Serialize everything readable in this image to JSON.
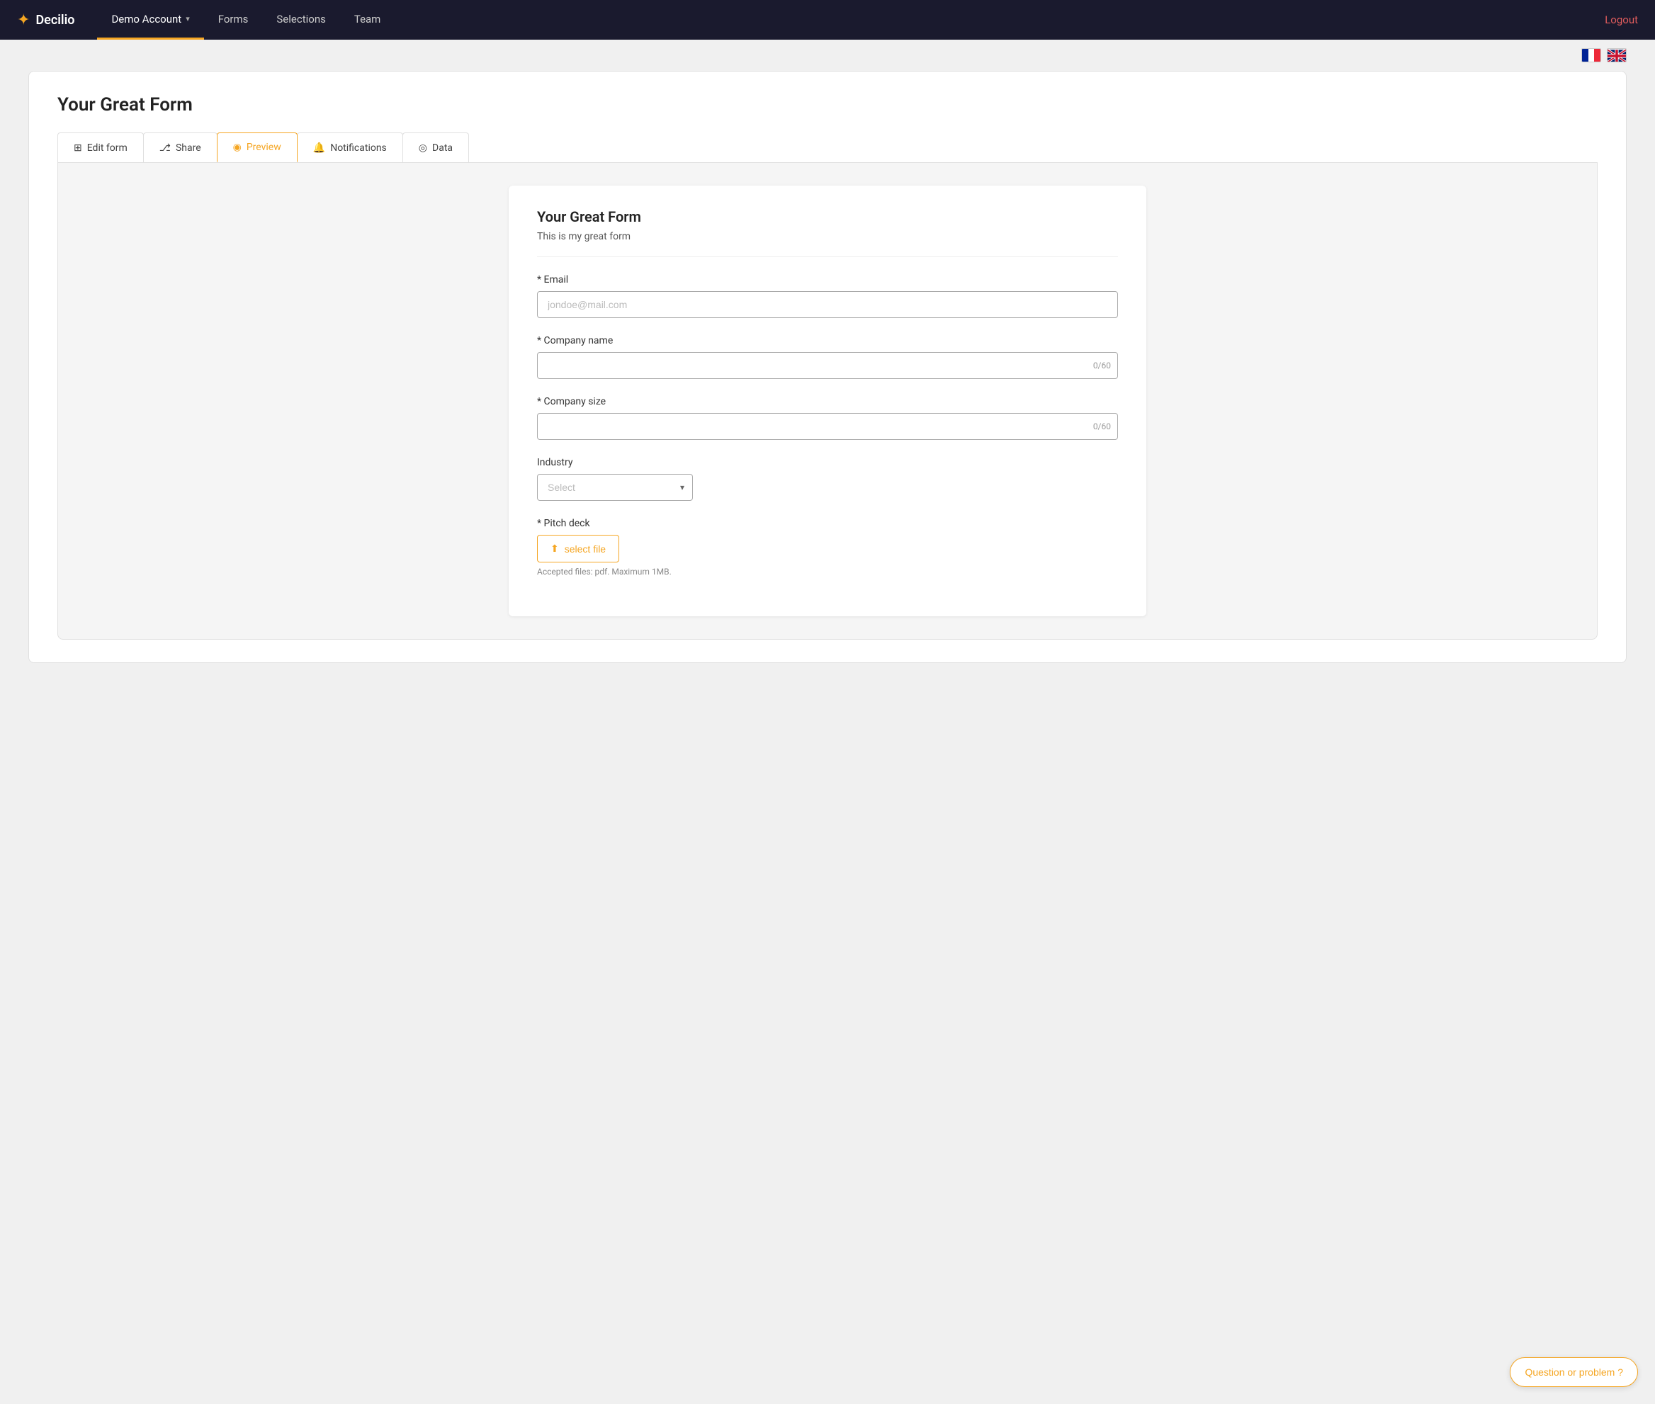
{
  "brand": {
    "logo_icon": "❯",
    "logo_text": "Decilio"
  },
  "navbar": {
    "items": [
      {
        "id": "demo-account",
        "label": "Demo Account",
        "active": true,
        "has_chevron": true
      },
      {
        "id": "forms",
        "label": "Forms",
        "active": false,
        "has_chevron": false
      },
      {
        "id": "selections",
        "label": "Selections",
        "active": false,
        "has_chevron": false
      },
      {
        "id": "team",
        "label": "Team",
        "active": false,
        "has_chevron": false
      }
    ],
    "logout_label": "Logout"
  },
  "page": {
    "form_title": "Your Great Form",
    "tabs": [
      {
        "id": "edit-form",
        "label": "Edit form",
        "icon": "⊞",
        "active": false
      },
      {
        "id": "share",
        "label": "Share",
        "icon": "⎇",
        "active": false
      },
      {
        "id": "preview",
        "label": "Preview",
        "icon": "◉",
        "active": true
      },
      {
        "id": "notifications",
        "label": "Notifications",
        "icon": "🔔",
        "active": false
      },
      {
        "id": "data",
        "label": "Data",
        "icon": "◎",
        "active": false
      }
    ]
  },
  "inner_form": {
    "title": "Your Great Form",
    "subtitle": "This is my great form",
    "fields": [
      {
        "id": "email",
        "label": "Email",
        "required": true,
        "type": "email",
        "placeholder": "jondoe@mail.com"
      },
      {
        "id": "company-name",
        "label": "Company name",
        "required": true,
        "type": "text-count",
        "placeholder": "",
        "char_count": "0/60"
      },
      {
        "id": "company-size",
        "label": "Company size",
        "required": true,
        "type": "text-count",
        "placeholder": "",
        "char_count": "0/60"
      },
      {
        "id": "industry",
        "label": "Industry",
        "required": false,
        "type": "select",
        "placeholder": "Select"
      },
      {
        "id": "pitch-deck",
        "label": "Pitch deck",
        "required": true,
        "type": "file",
        "button_label": "select file",
        "file_note": "Accepted files: pdf. Maximum 1MB."
      }
    ]
  },
  "help_button": {
    "label": "Question or problem ?"
  }
}
